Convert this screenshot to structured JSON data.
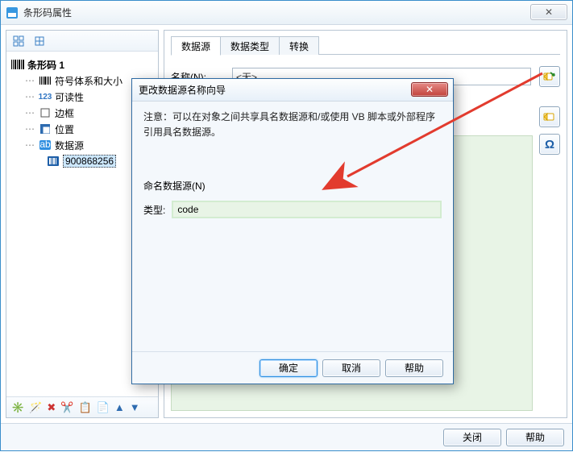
{
  "window": {
    "title": "条形码属性",
    "close_glyph": "✕"
  },
  "left": {
    "root": "条形码 1",
    "items": [
      {
        "label": "符号体系和大小"
      },
      {
        "label": "可读性",
        "icon_text": "123"
      },
      {
        "label": "边框"
      },
      {
        "label": "位置"
      },
      {
        "label": "数据源"
      }
    ],
    "data_value": "900868256"
  },
  "tabs": {
    "t1": "数据源",
    "t2": "数据类型",
    "t3": "转换"
  },
  "right": {
    "name_label": "名称(N):",
    "name_value": "<无>"
  },
  "dialog": {
    "title": "更改数据源名称向导",
    "note1": "注意：可以在对象之间共享具名数据源和/或使用 VB 脚本或外部程序",
    "note2": "引用具名数据源。",
    "section_label": "命名数据源(N)",
    "type_label": "类型:",
    "type_value": "code",
    "ok": "确定",
    "cancel": "取消",
    "help": "帮助",
    "close_glyph": "✕"
  },
  "footer": {
    "close": "关闭",
    "help": "帮助"
  },
  "colors": {
    "accent": "#2f8fe0",
    "arrow": "#e23b2e"
  }
}
